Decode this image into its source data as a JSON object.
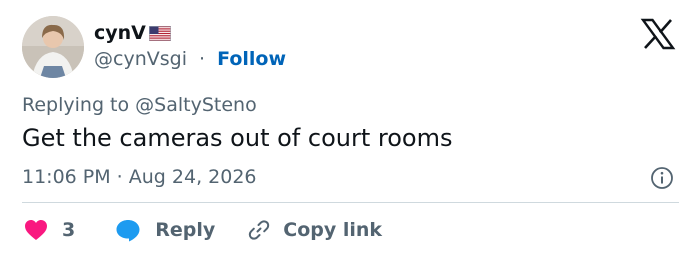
{
  "tweet": {
    "author": {
      "display_name": "cynV",
      "flag": "us-flag-emoji",
      "handle": "@cynVsgi",
      "separator": "·",
      "follow_label": "Follow"
    },
    "replying_prefix": "Replying to ",
    "replying_to": "@SaltySteno",
    "text": "Get the cameras out of court rooms",
    "timestamp": "11:06 PM · Aug 24, 2026",
    "actions": {
      "like_count": "3",
      "reply_label": "Reply",
      "copy_label": "Copy link"
    }
  },
  "colors": {
    "like": "#f91880",
    "reply": "#1d9bf0",
    "follow": "#0064b8",
    "secondary_text": "#536471"
  },
  "icons": [
    "x-logo-icon",
    "info-icon",
    "heart-icon",
    "reply-bubble-icon",
    "link-icon"
  ]
}
